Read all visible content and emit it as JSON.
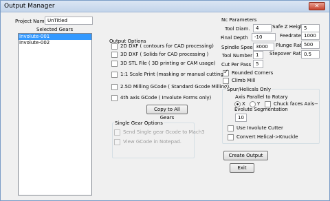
{
  "window": {
    "title": "Output Manager",
    "close_label": "✕"
  },
  "project": {
    "name_label": "Project Name",
    "name_value": "UnTitled",
    "selected_gears_label": "Selected Gears"
  },
  "gears": [
    {
      "label": "Involute-001",
      "selected": true
    },
    {
      "label": "Involute-002",
      "selected": false
    }
  ],
  "output_options": {
    "title": "Output Options",
    "items": [
      {
        "label": "2D DXF ( contours for CAD processing)",
        "checked": false
      },
      {
        "label": "3D DXF ( Solids for CAD processing )",
        "checked": false
      },
      {
        "label": "3D STL File ( 3D printing or CAM usage)",
        "checked": false
      },
      {
        "label": "1:1 Scale Print (masking or manual cutting)",
        "checked": false
      },
      {
        "label": "2.5D Milling GCode ( Standard Gcode Milling)",
        "checked": false
      },
      {
        "label": "4th axis GCode ( Involute Forms only)",
        "checked": false
      }
    ],
    "copy_button": "Copy to All Gears"
  },
  "single_gear": {
    "title": "Single Gear Options",
    "send_label": "Send Single gear Gcode to Mach3",
    "view_label": "View GCode in Notepad."
  },
  "nc": {
    "title": "Nc Parameters",
    "tool_diam_label": "Tool Diam.",
    "tool_diam_value": "4",
    "safe_z_label": "Safe Z Height",
    "safe_z_value": "5",
    "final_depth_label": "Final Depth",
    "final_depth_value": "-10",
    "feedrate_label": "Feedrate",
    "feedrate_value": "1000",
    "spindle_label": "Spindle Speed",
    "spindle_value": "3000",
    "plunge_label": "Plunge Rate",
    "plunge_value": "500",
    "tool_number_label": "Tool Number",
    "tool_number_value": "1",
    "stepover_label": "Stepover Ratio",
    "stepover_value": "0.5",
    "cut_per_pass_label": "Cut Per Pass",
    "cut_per_pass_value": "5",
    "rounded_corners_label": "Rounded Corners",
    "climb_mill_label": "Climb Mill"
  },
  "spur": {
    "title": "Spur/Helicals Only",
    "axis_label": "Axis Parallel to Rotary",
    "radio_x": "X",
    "radio_y": "Y",
    "chuck_label": "Chuck faces Axis--",
    "evolute_label": "Evolute Segmentation",
    "evolute_value": "10",
    "use_involute_label": "Use Involute Cutter",
    "convert_label": "Convert Helical->Knuckle"
  },
  "actions": {
    "create": "Create Output",
    "exit": "Exit"
  }
}
